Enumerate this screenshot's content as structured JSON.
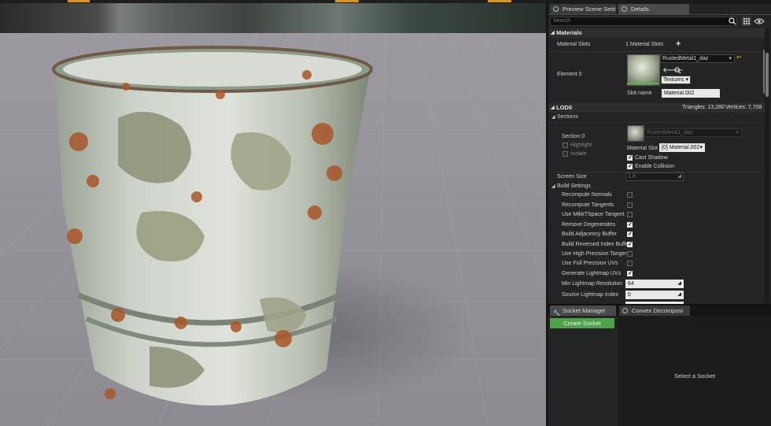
{
  "tabs": {
    "preview_scene_settings": "Preview Scene Setti",
    "details": "Details",
    "socket_manager": "Socket Manager",
    "convex_decomposition": "Convex Decomposi"
  },
  "search": {
    "placeholder": "Search"
  },
  "materials": {
    "category_label": "Materials",
    "slots_label": "Material Slots",
    "slots_count": "1 Material Slots",
    "element_label": "Element 0",
    "material_name": "RustedMetal1_daz",
    "textures_label": "Textures",
    "slot_name_label": "Slot name",
    "slot_name_value": "Material.002"
  },
  "lod": {
    "label": "LOD0",
    "triangles": "Triangles: 13,280",
    "vertices": "Vertices: 7,708",
    "sections_label": "Sections",
    "section_label": "Section 0",
    "highlight_label": "Highlight",
    "isolate_label": "Isolate",
    "section_material": "RustedMetal1_daz",
    "material_slot_label": "Material Slot",
    "material_slot_value": "[0] Material.002",
    "cast_shadow_label": "Cast Shadow",
    "enable_collision_label": "Enable Collision",
    "screen_size_label": "Screen Size",
    "screen_size_value": "1.0"
  },
  "build_settings": {
    "label": "Build Settings",
    "recompute_normals": "Recompute Normals",
    "recompute_tangents": "Recompute Tangents",
    "use_mikkt": "Use MikkTSpace Tangent",
    "remove_degenerates": "Remove Degenerates",
    "build_adjacency": "Build Adjacency Buffer",
    "build_reversed_index": "Build Reversed Index Buffe",
    "use_high_precision": "Use High Precision Tanger",
    "use_full_precision_uvs": "Use Full Precision UVs",
    "generate_lightmap_uvs": "Generate Lightmap UVs",
    "min_lightmap_resolution_label": "Min Lightmap Resolution",
    "min_lightmap_resolution_value": "64",
    "source_lightmap_index_label": "Source Lightmap Index",
    "source_lightmap_index_value": "0"
  },
  "checkbox_states": {
    "highlight": false,
    "isolate": false,
    "cast_shadow": true,
    "enable_collision": true,
    "recompute_normals": false,
    "recompute_tangents": false,
    "use_mikkt": false,
    "remove_degenerates": true,
    "build_adjacency": true,
    "build_reversed_index": true,
    "use_high_precision": false,
    "use_full_precision_uvs": false,
    "generate_lightmap_uvs": true
  },
  "socket": {
    "create_label": "Create Socket",
    "select_label": "Select a Socket"
  },
  "colors": {
    "accent_orange": "#d7942b",
    "create_button": "#4ea24b",
    "panel_bg": "#242424",
    "viewport_floor": "#a29ea6"
  }
}
